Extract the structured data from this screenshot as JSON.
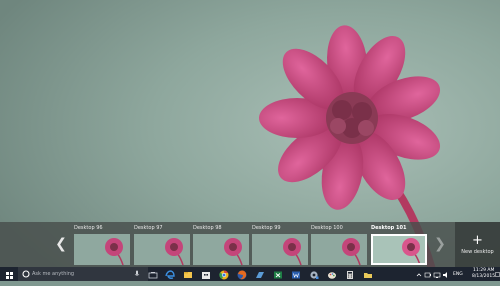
{
  "task_view": {
    "nav_left_icon": "chevron-left-icon",
    "nav_right_icon": "chevron-right-icon",
    "desktops": [
      {
        "label": "Desktop 96",
        "active": false
      },
      {
        "label": "Desktop 97",
        "active": false
      },
      {
        "label": "Desktop 98",
        "active": false
      },
      {
        "label": "Desktop 99",
        "active": false
      },
      {
        "label": "Desktop 100",
        "active": false
      },
      {
        "label": "Desktop 101",
        "active": true
      }
    ],
    "new_desktop": {
      "icon": "plus-icon",
      "label": "New desktop"
    }
  },
  "taskbar": {
    "start_icon": "windows-logo-icon",
    "search_placeholder": "Ask me anything",
    "mic_icon": "microphone-icon",
    "pinned_apps": [
      {
        "name": "task-view-icon",
        "color": "#c9ced6"
      },
      {
        "name": "edge-icon",
        "color": "#3b8fe0"
      },
      {
        "name": "file-explorer-icon",
        "color": "#f2c44d"
      },
      {
        "name": "store-icon",
        "color": "#e8e8e8"
      },
      {
        "name": "chrome-icon",
        "color": "#e8b21f"
      },
      {
        "name": "firefox-icon",
        "color": "#e66a1f"
      },
      {
        "name": "app-icon",
        "color": "#5b9bd5"
      },
      {
        "name": "excel-icon",
        "color": "#1e7e45"
      },
      {
        "name": "word-icon",
        "color": "#2b5fae"
      },
      {
        "name": "app-gear-icon",
        "color": "#a7b3c2"
      },
      {
        "name": "paint-icon",
        "color": "#d34a4a"
      },
      {
        "name": "calculator-icon",
        "color": "#d9d9d9"
      },
      {
        "name": "folder-icon",
        "color": "#e9c95a"
      }
    ],
    "tray": {
      "language": "ENG",
      "time": "11:29 AM",
      "date": "8/13/2015"
    }
  }
}
